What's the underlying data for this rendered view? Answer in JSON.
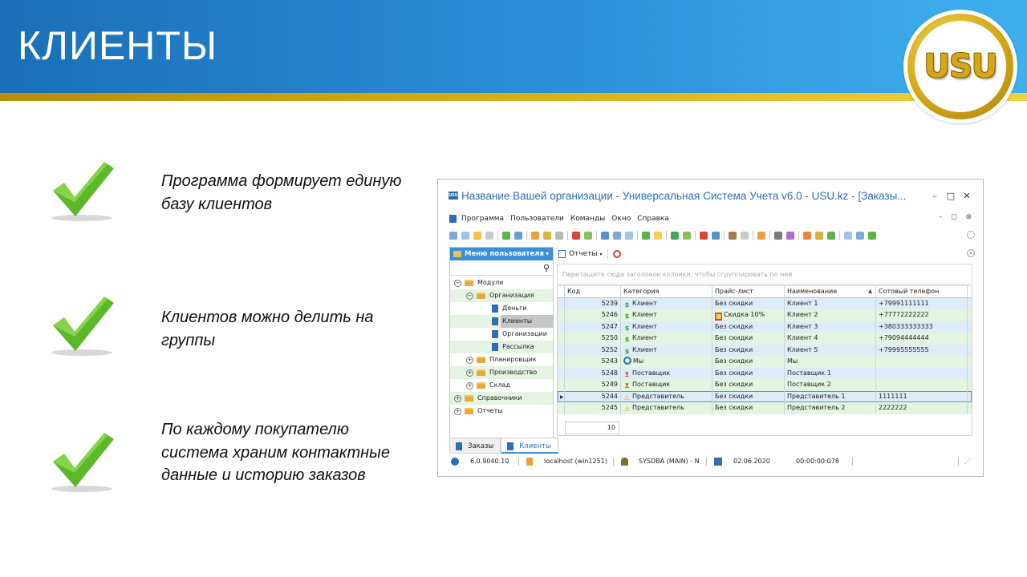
{
  "slide": {
    "title": "КЛИЕНТЫ",
    "logo_text": "USU",
    "colors": {
      "header_blue": "#1a6fb8",
      "header_light": "#3fb0ee",
      "gold": "#d4a817",
      "check_green": "#5cb82a"
    }
  },
  "bullets": [
    {
      "icon": "checkmark-icon",
      "text": "Программа формирует единую базу клиентов"
    },
    {
      "icon": "checkmark-icon",
      "text": "Клиентов можно делить на группы"
    },
    {
      "icon": "checkmark-icon",
      "text": "По каждому покупателю система храним контактные данные и историю заказов"
    }
  ],
  "app": {
    "title": "Название Вашей организации - Универсальная Система Учета v6.0 - USU.kz - [Заказы...",
    "app_icon_text": "USU",
    "window_controls": {
      "minimize": "–",
      "maximize": "□",
      "close": "✕"
    },
    "menu": [
      "Программа",
      "Пользователи",
      "Команды",
      "Окно",
      "Справка"
    ],
    "mdi_controls": "– ◻ ⊗",
    "user_menu": {
      "title": "Меню пользователя",
      "pin": "▾",
      "tree": [
        {
          "label": "Модули",
          "level": 0,
          "type": "folder",
          "expander": "−"
        },
        {
          "label": "Организация",
          "level": 1,
          "type": "folder",
          "expander": "−"
        },
        {
          "label": "Деньги",
          "level": 2,
          "type": "doc"
        },
        {
          "label": "Клиенты",
          "level": 2,
          "type": "doc",
          "selected": true
        },
        {
          "label": "Организации",
          "level": 2,
          "type": "doc"
        },
        {
          "label": "Рассылка",
          "level": 2,
          "type": "doc"
        },
        {
          "label": "Планировщик",
          "level": 1,
          "type": "folder",
          "expander": "+"
        },
        {
          "label": "Производство",
          "level": 1,
          "type": "folder",
          "expander": "+"
        },
        {
          "label": "Склад",
          "level": 1,
          "type": "folder",
          "expander": "+"
        },
        {
          "label": "Справочники",
          "level": 0,
          "type": "folder",
          "expander": "+"
        },
        {
          "label": "Отчеты",
          "level": 0,
          "type": "folder",
          "expander": "+"
        }
      ]
    },
    "tabs": [
      {
        "label": "Заказы",
        "active": false
      },
      {
        "label": "Клиенты",
        "active": true
      }
    ],
    "reports_button": "Отчеты",
    "group_hint": "Перетащите сюда заголовок колонки, чтобы сгруппировать по ней",
    "grid": {
      "columns": [
        "Код",
        "Категория",
        "Прайс-лист",
        "Наименование",
        "Сотовый телефон"
      ],
      "rows": [
        {
          "kod": "5239",
          "cat": "Клиент",
          "cat_icon": "dollar-icon",
          "price": "Без скидки",
          "name": "Клиент 1",
          "phone": "+79991111111",
          "color": "blue"
        },
        {
          "kod": "5246",
          "cat": "Клиент",
          "cat_icon": "dollar-icon",
          "price": "Скидка 10%",
          "price_icon": "gift-icon",
          "name": "Клиент 2",
          "phone": "+77772222222",
          "color": "green"
        },
        {
          "kod": "5247",
          "cat": "Клиент",
          "cat_icon": "dollar-icon",
          "price": "Без скидки",
          "name": "Клиент 3",
          "phone": "+380333333333",
          "color": "blue"
        },
        {
          "kod": "5250",
          "cat": "Клиент",
          "cat_icon": "dollar-icon",
          "price": "Без скидки",
          "name": "Клиент 4",
          "phone": "+79094444444",
          "color": "green"
        },
        {
          "kod": "5252",
          "cat": "Клиент",
          "cat_icon": "dollar-icon",
          "price": "Без скидки",
          "name": "Клиент 5",
          "phone": "+79995555555",
          "color": "blue"
        },
        {
          "kod": "5243",
          "cat": "Мы",
          "cat_icon": "target-icon",
          "price": "Без скидки",
          "name": "Мы",
          "phone": "",
          "color": "green"
        },
        {
          "kod": "5248",
          "cat": "Поставщик",
          "cat_icon": "cart-icon",
          "price": "Без скидки",
          "name": "Поставщик 1",
          "phone": "",
          "color": "blue"
        },
        {
          "kod": "5249",
          "cat": "Поставщик",
          "cat_icon": "cart-icon",
          "price": "Без скидки",
          "name": "Поставщик 2",
          "phone": "",
          "color": "green"
        },
        {
          "kod": "5244",
          "cat": "Представитель",
          "cat_icon": "warning-icon",
          "price": "Без скидки",
          "name": "Представитель 1",
          "phone": "1111111",
          "color": "blue",
          "current": true
        },
        {
          "kod": "5245",
          "cat": "Представитель",
          "cat_icon": "warning-icon",
          "price": "Без скидки",
          "name": "Представитель 2",
          "phone": "2222222",
          "color": "green"
        }
      ],
      "row_count": "10"
    },
    "status": {
      "version": "6.0.9040.10",
      "server": "localhost (win1251)",
      "user": "SYSDBA (MAIN) - N",
      "date": "02.06.2020",
      "timer": "00:00:00:078"
    }
  }
}
